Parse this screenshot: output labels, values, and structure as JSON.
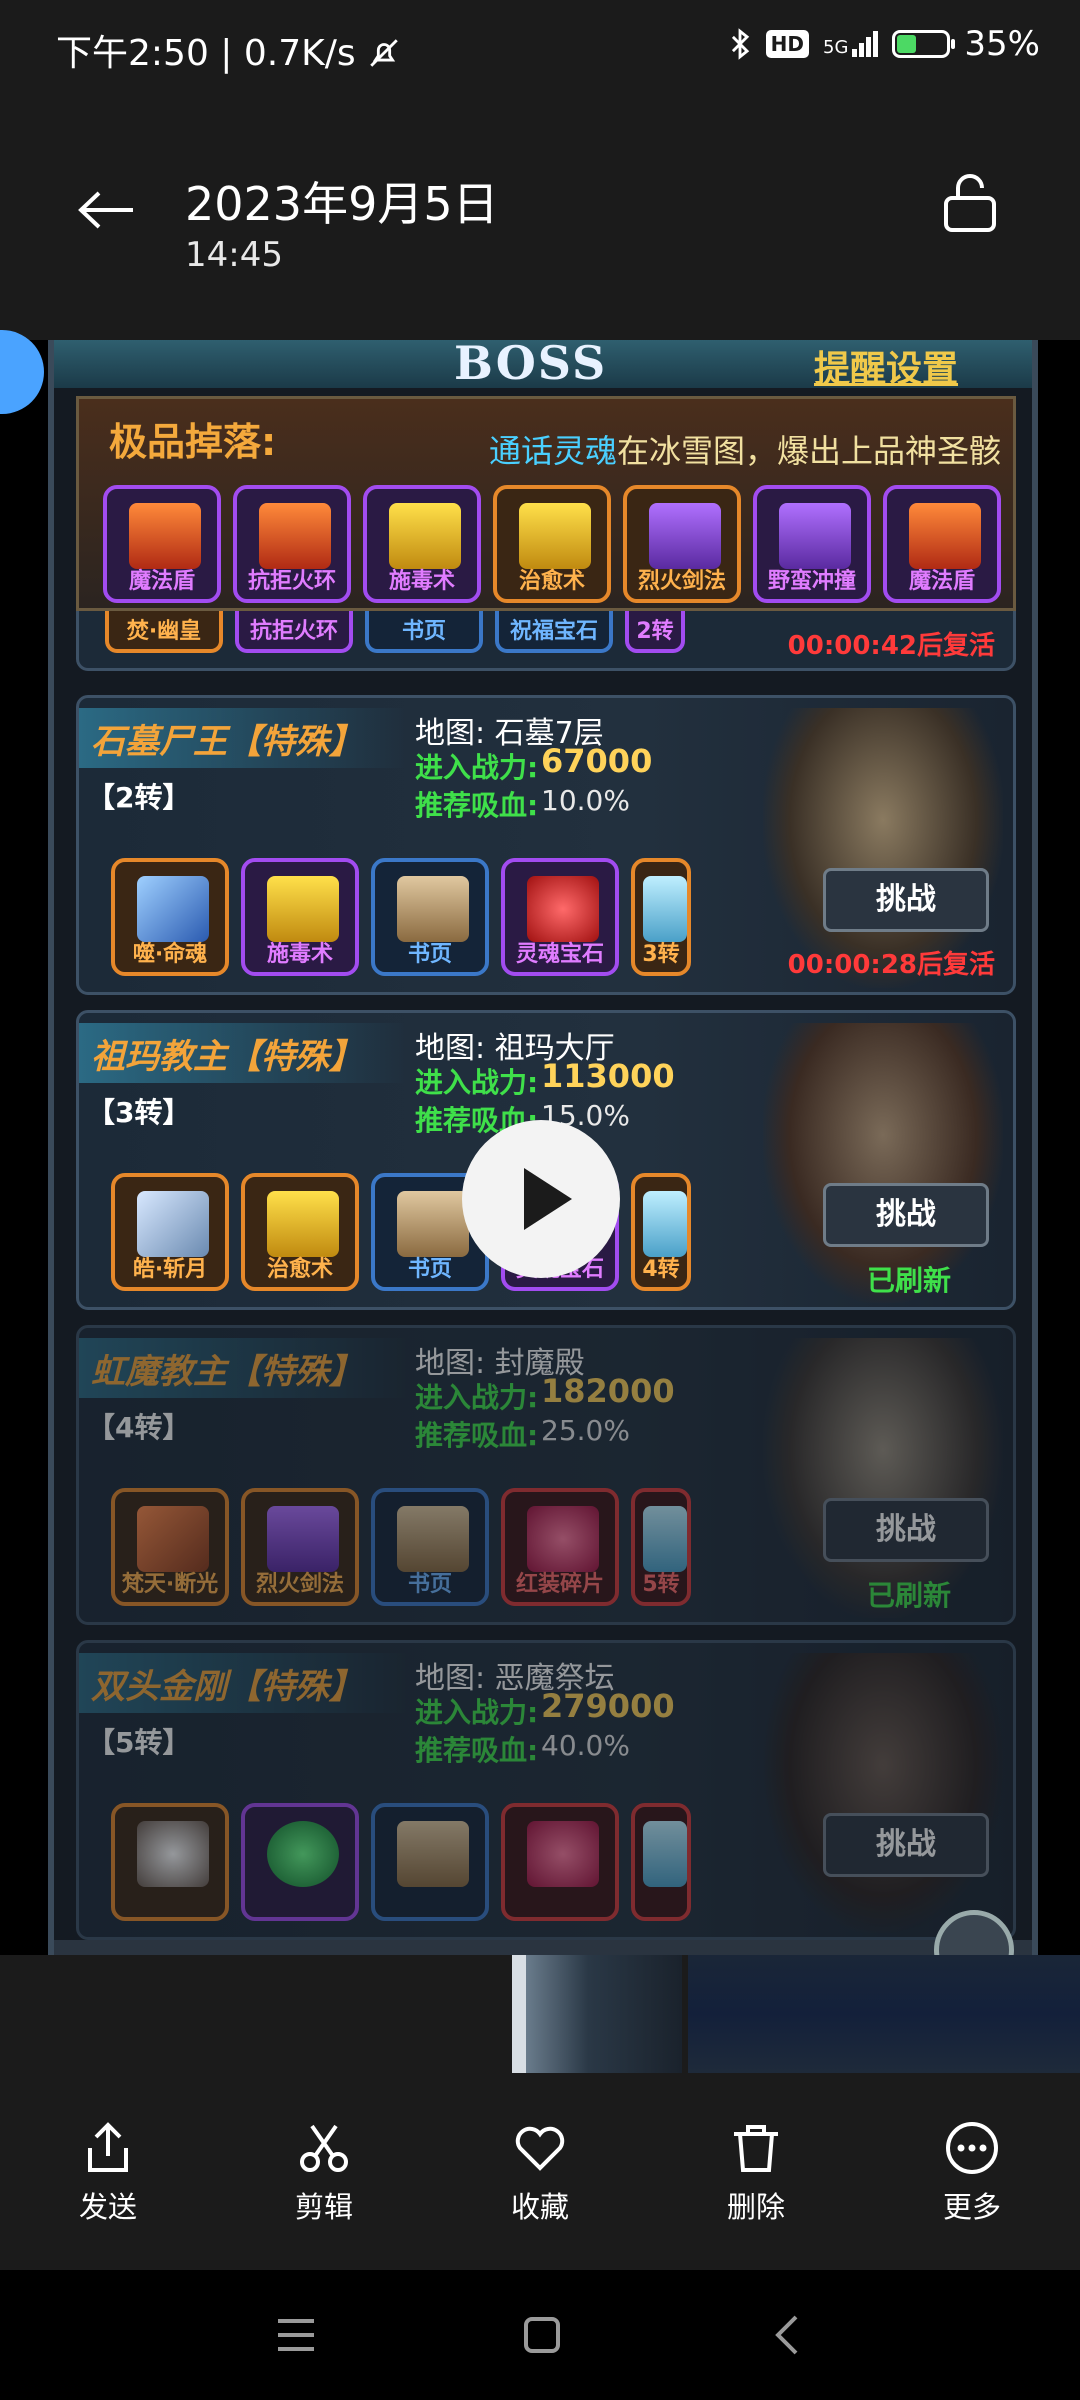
{
  "status_bar": {
    "left_text": "下午2:50 | 0.7K/s",
    "network": "5G",
    "hd": "HD",
    "battery": "35%",
    "battery_level": 0.35
  },
  "header": {
    "date": "2023年9月5日",
    "time": "14:45"
  },
  "game": {
    "title": "BOSS",
    "remind_link": "提醒设置",
    "loot": {
      "title": "极品掉落:",
      "ticker_highlight": "通话灵魂",
      "ticker_rest": "在冰雪图，爆出上品神圣骸",
      "items": [
        {
          "label": "魔法盾",
          "color": "purple"
        },
        {
          "label": "抗拒火环",
          "color": "purple"
        },
        {
          "label": "施毒术",
          "color": "purple"
        },
        {
          "label": "治愈术",
          "color": "orange"
        },
        {
          "label": "烈火剑法",
          "color": "orange"
        },
        {
          "label": "野蛮冲撞",
          "color": "purple"
        },
        {
          "label": "魔法盾",
          "color": "purple"
        }
      ]
    },
    "partial_row": {
      "items": [
        "焚·幽皇",
        "抗拒火环",
        "书页",
        "祝福宝石",
        "2转"
      ],
      "respawn": "00:00:42后复活"
    },
    "bosses": [
      {
        "name": "石墓尸王【特殊】",
        "tier": "【2转】",
        "map": "地图: 石墓7层",
        "power_label": "进入战力:",
        "power_value": "67000",
        "blood_label": "推荐吸血:",
        "blood_value": "10.0%",
        "items": [
          "噬·命魂",
          "施毒术",
          "书页",
          "灵魂宝石",
          "3转"
        ],
        "button": "挑战",
        "status": "00:00:28后复活"
      },
      {
        "name": "祖玛教主【特殊】",
        "tier": "【3转】",
        "map": "地图: 祖玛大厅",
        "power_label": "进入战力:",
        "power_value": "113000",
        "blood_label": "推荐吸血:",
        "blood_value": "15.0%",
        "items": [
          "皓·斩月",
          "治愈术",
          "书页",
          "灵魂宝石",
          "4转"
        ],
        "button": "挑战",
        "status": "已刷新"
      },
      {
        "name": "虹魔教主【特殊】",
        "tier": "【4转】",
        "map": "地图: 封魔殿",
        "power_label": "进入战力:",
        "power_value": "182000",
        "blood_label": "推荐吸血:",
        "blood_value": "25.0%",
        "items": [
          "梵天·断光",
          "烈火剑法",
          "书页",
          "红装碎片",
          "5转"
        ],
        "button": "挑战",
        "status": "已刷新"
      },
      {
        "name": "双头金刚【特殊】",
        "tier": "【5转】",
        "map": "地图: 恶魔祭坛",
        "power_label": "进入战力:",
        "power_value": "279000",
        "blood_label": "推荐吸血:",
        "blood_value": "40.0%",
        "button": "挑战"
      }
    ]
  },
  "actions": [
    {
      "label": "发送",
      "icon": "share-icon"
    },
    {
      "label": "剪辑",
      "icon": "scissors-icon"
    },
    {
      "label": "收藏",
      "icon": "heart-icon"
    },
    {
      "label": "删除",
      "icon": "trash-icon"
    },
    {
      "label": "更多",
      "icon": "more-icon"
    }
  ]
}
